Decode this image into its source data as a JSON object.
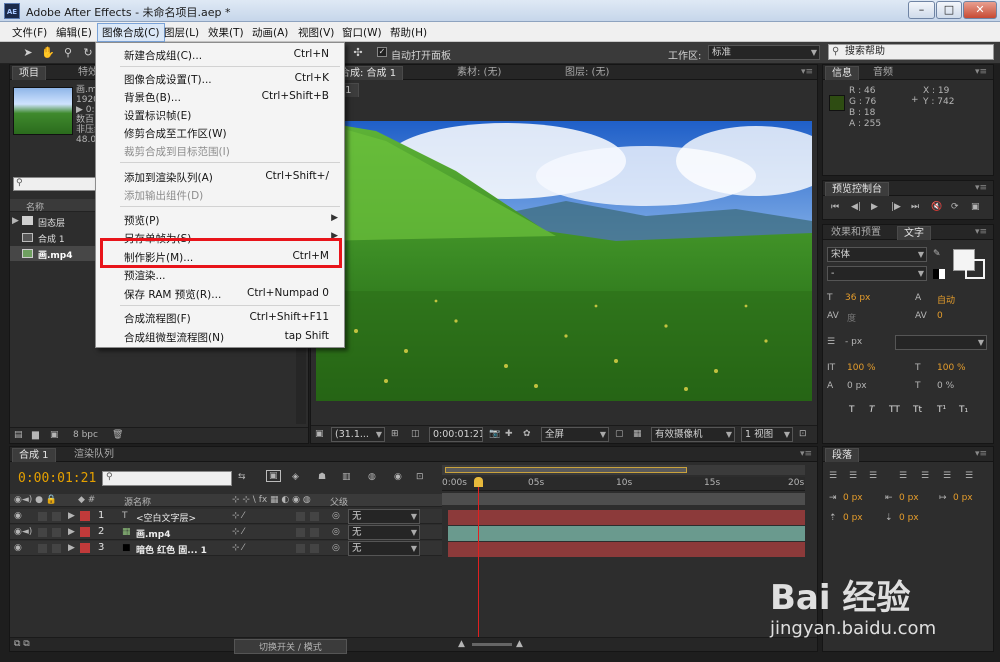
{
  "window": {
    "icon_text": "AE",
    "title": "Adobe After Effects - 未命名项目.aep *",
    "minimize": "–",
    "maximize": "□",
    "close": "✕"
  },
  "menubar": [
    "文件(F)",
    "编辑(E)",
    "图像合成(C)",
    "图层(L)",
    "效果(T)",
    "动画(A)",
    "视图(V)",
    "窗口(W)",
    "帮助(H)"
  ],
  "toolbar": {
    "auto_open_label": "自动打开面板",
    "workspace_label": "工作区:",
    "workspace_value": "标准",
    "search_placeholder": "搜索帮助"
  },
  "dropdown": {
    "items": [
      {
        "label": "新建合成组(C)...",
        "shortcut": "Ctrl+N",
        "disabled": false
      },
      {
        "label": "图像合成设置(T)...",
        "shortcut": "Ctrl+K",
        "disabled": false
      },
      {
        "label": "背景色(B)...",
        "shortcut": "Ctrl+Shift+B",
        "disabled": false
      },
      {
        "label": "设置标识帧(E)",
        "shortcut": "",
        "disabled": false
      },
      {
        "label": "修剪合成至工作区(W)",
        "shortcut": "",
        "disabled": false
      },
      {
        "label": "裁剪合成到目标范围(I)",
        "shortcut": "",
        "disabled": true
      },
      {
        "label": "添加到渲染队列(A)",
        "shortcut": "Ctrl+Shift+/",
        "disabled": false
      },
      {
        "label": "添加输出组件(D)",
        "shortcut": "",
        "disabled": true
      },
      {
        "label": "预览(P)",
        "shortcut": "",
        "disabled": false,
        "submenu": true
      },
      {
        "label": "另存单帧为(S)",
        "shortcut": "",
        "disabled": false,
        "submenu": true
      },
      {
        "label": "制作影片(M)...",
        "shortcut": "Ctrl+M",
        "disabled": false
      },
      {
        "label": "预渲染...",
        "shortcut": "",
        "disabled": false
      },
      {
        "label": "保存 RAM 预览(R)...",
        "shortcut": "Ctrl+Numpad 0",
        "disabled": false
      },
      {
        "label": "合成流程图(F)",
        "shortcut": "Ctrl+Shift+F11",
        "disabled": false
      },
      {
        "label": "合成组微型流程图(N)",
        "shortcut": "tap Shift",
        "disabled": false
      }
    ]
  },
  "project": {
    "tabs": [
      "项目",
      "特效"
    ],
    "thumb_info": [
      "画.mp4",
      "1920",
      "▶ 0:03",
      "数百",
      "非压缩",
      "48.00"
    ],
    "col_name": "名称",
    "items": [
      {
        "name": "固态层",
        "type": "folder"
      },
      {
        "name": "合成 1",
        "type": "comp"
      },
      {
        "name": "画.mp4",
        "type": "footage"
      }
    ],
    "bpc": "8 bpc"
  },
  "viewer": {
    "tabs": [
      "图像合成: 合成 1",
      "素材: (无)",
      "图层: (无)"
    ],
    "breadcrumb": "合成 1",
    "zoom": "(31.1...",
    "timecode": "0:00:01:21",
    "resolution": "全屏",
    "camera": "有效摄像机",
    "views": "1 视图"
  },
  "info": {
    "tabs": [
      "信息",
      "音频"
    ],
    "rgb": [
      "R : 46",
      "G : 76",
      "B : 18",
      "A : 255"
    ],
    "xy": [
      "X : 19",
      "Y : 742"
    ],
    "swatch_color": "#2e4c12"
  },
  "preview": {
    "title": "预览控制台",
    "buttons": [
      "⏮",
      "◀|",
      "▶",
      "|▶",
      "⏭",
      "🔇",
      "⟳",
      "▣"
    ]
  },
  "character": {
    "tabs": [
      "效果和预置",
      "文字"
    ],
    "font": "宋体",
    "style": "-",
    "size": "36 px",
    "leading": "自动",
    "kerning": "度",
    "tracking": "0",
    "stroke": "- px",
    "vscale": "100 %",
    "hscale": "100 %",
    "baseline": "0 px",
    "tsume": "0 %",
    "styles": [
      "T",
      "T",
      "TT",
      "Tt",
      "T¹",
      "T₁"
    ]
  },
  "paragraph": {
    "title": "段落",
    "indents": [
      "0 px",
      "0 px",
      "0 px",
      "0 px",
      "0 px"
    ]
  },
  "timeline": {
    "tabs": [
      "合成 1",
      "渲染队列"
    ],
    "timecode": "0:00:01:21",
    "col_source": "源名称",
    "col_parent": "父级",
    "ruler": [
      "0:00s",
      "05s",
      "10s",
      "15s",
      "20s"
    ],
    "parent_none": "无",
    "layers": [
      {
        "num": "1",
        "name": "<空白文字层>",
        "color": "#c13a3a",
        "bar": "#8c3a3a",
        "icon": "T"
      },
      {
        "num": "2",
        "name": "画.mp4",
        "color": "#c13a3a",
        "bar": "#6a9a8e",
        "icon": "▦"
      },
      {
        "num": "3",
        "name": "暗色 红色 固... 1",
        "color": "#c13a3a",
        "bar": "#8c3a3a",
        "icon": "■"
      }
    ],
    "toggle_label": "切换开关 / 模式"
  },
  "watermark": {
    "brand": "Bai 经验",
    "url": "jingyan.baidu.com"
  }
}
